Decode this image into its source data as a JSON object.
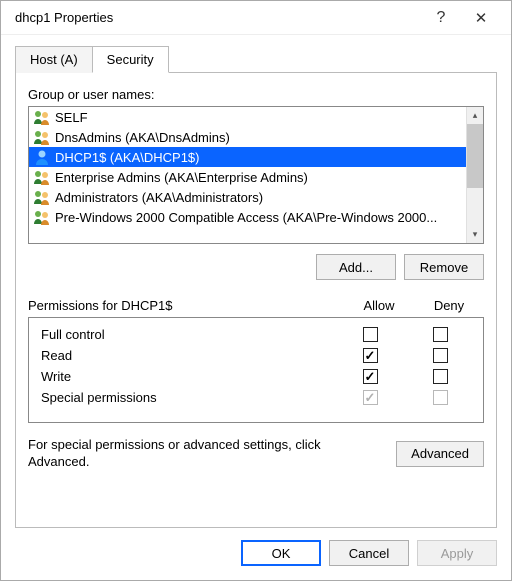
{
  "window": {
    "title": "dhcp1 Properties",
    "help": "?",
    "close": "✕"
  },
  "tabs": [
    {
      "label": "Host (A)",
      "active": false
    },
    {
      "label": "Security",
      "active": true
    }
  ],
  "groupLabel": "Group or user names:",
  "principals": [
    {
      "name": "SELF",
      "type": "group",
      "selected": false
    },
    {
      "name": "DnsAdmins (AKA\\DnsAdmins)",
      "type": "group",
      "selected": false
    },
    {
      "name": "DHCP1$ (AKA\\DHCP1$)",
      "type": "user",
      "selected": true
    },
    {
      "name": "Enterprise Admins (AKA\\Enterprise Admins)",
      "type": "group",
      "selected": false
    },
    {
      "name": "Administrators (AKA\\Administrators)",
      "type": "group",
      "selected": false
    },
    {
      "name": "Pre-Windows 2000 Compatible Access (AKA\\Pre-Windows 2000...",
      "type": "group",
      "selected": false
    }
  ],
  "buttons": {
    "add": "Add...",
    "remove": "Remove",
    "advanced": "Advanced",
    "ok": "OK",
    "cancel": "Cancel",
    "apply": "Apply"
  },
  "permHeader": {
    "title": "Permissions for DHCP1$",
    "allow": "Allow",
    "deny": "Deny"
  },
  "permissions": [
    {
      "name": "Full control",
      "allow": false,
      "deny": false,
      "disabled": false
    },
    {
      "name": "Read",
      "allow": true,
      "deny": false,
      "disabled": false
    },
    {
      "name": "Write",
      "allow": true,
      "deny": false,
      "disabled": false
    },
    {
      "name": "Special permissions",
      "allow": true,
      "deny": false,
      "disabled": true
    }
  ],
  "footerText": "For special permissions or advanced settings, click Advanced."
}
